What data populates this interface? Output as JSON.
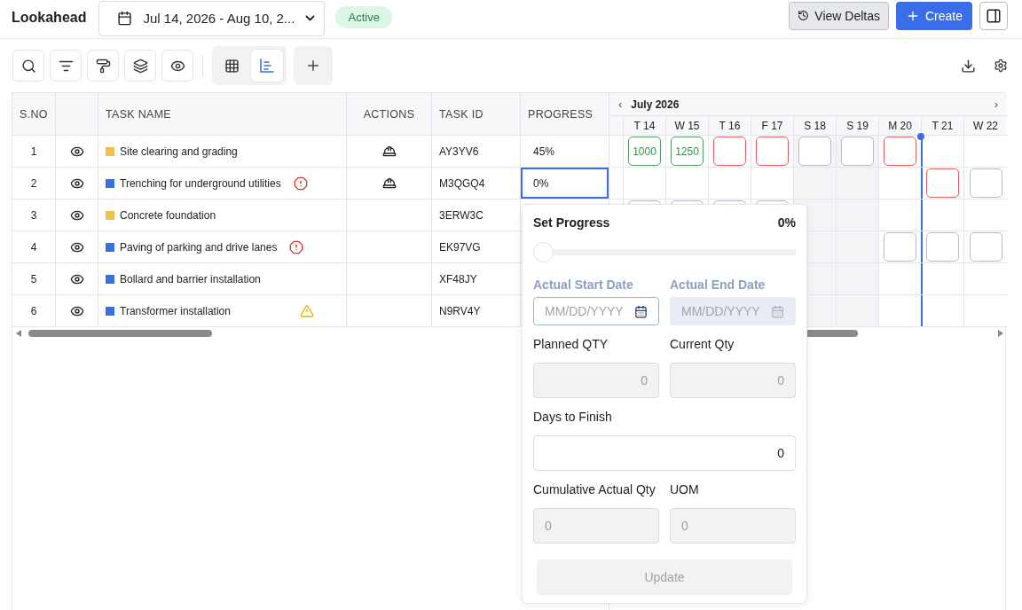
{
  "header": {
    "title": "Lookahead",
    "date_range": "Jul 14, 2026 - Aug 10, 2...",
    "status": "Active",
    "view_deltas": "View Deltas",
    "create": "Create"
  },
  "toolbar": {
    "view_modes": [
      {
        "kind": "grid",
        "selected": false
      },
      {
        "kind": "gantt",
        "selected": true
      }
    ]
  },
  "table": {
    "columns": [
      "S.NO",
      "",
      "TASK NAME",
      "ACTIONS",
      "TASK ID",
      "PROGRESS"
    ],
    "month": "July 2026",
    "prev": "‹",
    "next": "›",
    "days": [
      {
        "label": "T 14",
        "weekend": false,
        "today": false
      },
      {
        "label": "W 15",
        "weekend": false,
        "today": false
      },
      {
        "label": "T 16",
        "weekend": false,
        "today": false
      },
      {
        "label": "F 17",
        "weekend": false,
        "today": false
      },
      {
        "label": "S 18",
        "weekend": true,
        "today": false
      },
      {
        "label": "S 19",
        "weekend": true,
        "today": false
      },
      {
        "label": "M 20",
        "weekend": false,
        "today": false
      },
      {
        "label": "T 21",
        "weekend": false,
        "today": true
      },
      {
        "label": "W 22",
        "weekend": false,
        "today": false
      }
    ],
    "rows": [
      {
        "sno": "1",
        "name": "Site clearing and grading",
        "color": "#f0c04a",
        "error": false,
        "warning": false,
        "assigned": true,
        "task_id": "AY3YV6",
        "progress": "45%",
        "selected": false,
        "cells": [
          {
            "kind": "done",
            "value": "1000"
          },
          {
            "kind": "done",
            "value": "1250"
          },
          {
            "kind": "late"
          },
          {
            "kind": "late"
          },
          {
            "kind": "pending"
          },
          {
            "kind": "pending"
          },
          {
            "kind": "late"
          },
          {
            "kind": "none"
          },
          {
            "kind": "none"
          }
        ]
      },
      {
        "sno": "2",
        "name": "Trenching for underground utilities",
        "color": "#3b6fe0",
        "error": true,
        "warning": false,
        "assigned": true,
        "task_id": "M3QGQ4",
        "progress": "0%",
        "selected": true,
        "cells": [
          {
            "kind": "none"
          },
          {
            "kind": "none"
          },
          {
            "kind": "none"
          },
          {
            "kind": "none"
          },
          {
            "kind": "none"
          },
          {
            "kind": "none"
          },
          {
            "kind": "none"
          },
          {
            "kind": "late"
          },
          {
            "kind": "pending"
          }
        ]
      },
      {
        "sno": "3",
        "name": "Concrete foundation",
        "color": "#f0c04a",
        "error": false,
        "warning": false,
        "assigned": false,
        "task_id": "3ERW3C",
        "progress": "",
        "selected": false,
        "cells": [
          {
            "kind": "pending"
          },
          {
            "kind": "pending"
          },
          {
            "kind": "pending"
          },
          {
            "kind": "pending"
          },
          {
            "kind": "none"
          },
          {
            "kind": "none"
          },
          {
            "kind": "none"
          },
          {
            "kind": "none"
          },
          {
            "kind": "none"
          }
        ]
      },
      {
        "sno": "4",
        "name": "Paving of parking and drive lanes",
        "color": "#3b6fe0",
        "error": true,
        "warning": false,
        "assigned": false,
        "task_id": "EK97VG",
        "progress": "",
        "selected": false,
        "cells": [
          {
            "kind": "none"
          },
          {
            "kind": "none"
          },
          {
            "kind": "none"
          },
          {
            "kind": "none"
          },
          {
            "kind": "none"
          },
          {
            "kind": "none"
          },
          {
            "kind": "pending"
          },
          {
            "kind": "pending"
          },
          {
            "kind": "pending"
          }
        ]
      },
      {
        "sno": "5",
        "name": "Bollard and barrier installation",
        "color": "#3b6fe0",
        "error": false,
        "warning": false,
        "assigned": false,
        "task_id": "XF48JY",
        "progress": "",
        "selected": false,
        "cells": [
          {
            "kind": "none"
          },
          {
            "kind": "none"
          },
          {
            "kind": "none"
          },
          {
            "kind": "none"
          },
          {
            "kind": "none"
          },
          {
            "kind": "none"
          },
          {
            "kind": "none"
          },
          {
            "kind": "none"
          },
          {
            "kind": "none"
          }
        ]
      },
      {
        "sno": "6",
        "name": "Transformer installation",
        "color": "#3b6fe0",
        "error": false,
        "warning": true,
        "assigned": false,
        "task_id": "N9RV4Y",
        "progress": "",
        "selected": false,
        "cells": [
          {
            "kind": "none"
          },
          {
            "kind": "none"
          },
          {
            "kind": "none"
          },
          {
            "kind": "none"
          },
          {
            "kind": "none"
          },
          {
            "kind": "none"
          },
          {
            "kind": "none"
          },
          {
            "kind": "none"
          },
          {
            "kind": "none"
          }
        ]
      }
    ]
  },
  "popover": {
    "title": "Set Progress",
    "value": "0%",
    "level": 0,
    "fields": [
      {
        "kind": "date",
        "label": "Actual Start Date",
        "placeholder": "MM/DD/YYYY",
        "disabled": false
      },
      {
        "kind": "date",
        "label": "Actual End Date",
        "placeholder": "MM/DD/YYYY",
        "disabled": true
      },
      {
        "kind": "quantity",
        "label": "Planned QTY",
        "value": "0",
        "disabled": true
      },
      {
        "kind": "quantity",
        "label": "Current Qty",
        "value": "0",
        "disabled": true
      },
      {
        "kind": "wide",
        "label": "Days to Finish",
        "value": "0",
        "disabled": false
      },
      {
        "kind": "text",
        "label": "Cumulative Actual Qty",
        "value": "0",
        "disabled": true
      },
      {
        "kind": "text",
        "label": "UOM",
        "value": "0",
        "disabled": true
      }
    ],
    "button": {
      "label": "Update",
      "disabled": true
    }
  }
}
